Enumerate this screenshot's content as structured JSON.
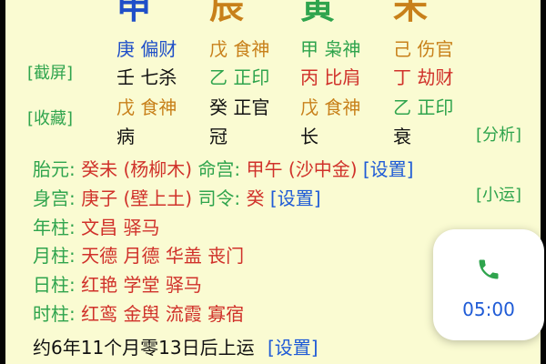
{
  "pillars": [
    {
      "char": "申",
      "color": "#1f4fc8"
    },
    {
      "char": "辰",
      "color": "#c8801a"
    },
    {
      "char": "寅",
      "color": "#2fa44d"
    },
    {
      "char": "未",
      "color": "#c8801a"
    }
  ],
  "hidden_stems": {
    "row1": [
      "庚 偏财",
      "戊 食神",
      "甲 枭神",
      "己 伤官"
    ],
    "row2": [
      "壬 七杀",
      "乙 正印",
      "丙 比肩",
      "丁 劫财"
    ],
    "row3": [
      "戊 食神",
      "癸 正官",
      "戊 食神",
      "乙 正印"
    ],
    "row4": [
      "病",
      "冠",
      "长",
      "衰"
    ]
  },
  "side_buttons": {
    "screenshot": "[截屏]",
    "favorite": "[收藏]",
    "analyze": "[分析]",
    "minor_luck": "[小运]"
  },
  "info": {
    "taiyuan_label": "胎元:",
    "taiyuan_value": "癸未 (杨柳木)",
    "minggong_label": "命宫:",
    "minggong_value": "甲午 (沙中金)",
    "shengong_label": "身宫:",
    "shengong_value": "庚子 (壁上土)",
    "siling_label": "司令:",
    "siling_value": "癸",
    "set_label": "[设置]",
    "year_label": "年柱:",
    "year_value": "文昌 驿马",
    "month_label": "月柱:",
    "month_value": "天德 月德 华盖 丧门",
    "day_label": "日柱:",
    "day_value": "红艳 学堂 驿马",
    "hour_label": "时柱:",
    "hour_value": "红鸾 金舆 流霞 寡宿",
    "luck_start": "约6年11个月零13日后上运"
  },
  "call_widget": {
    "icon": "phone-icon",
    "time": "05:00",
    "accent": "#2fa44d"
  }
}
